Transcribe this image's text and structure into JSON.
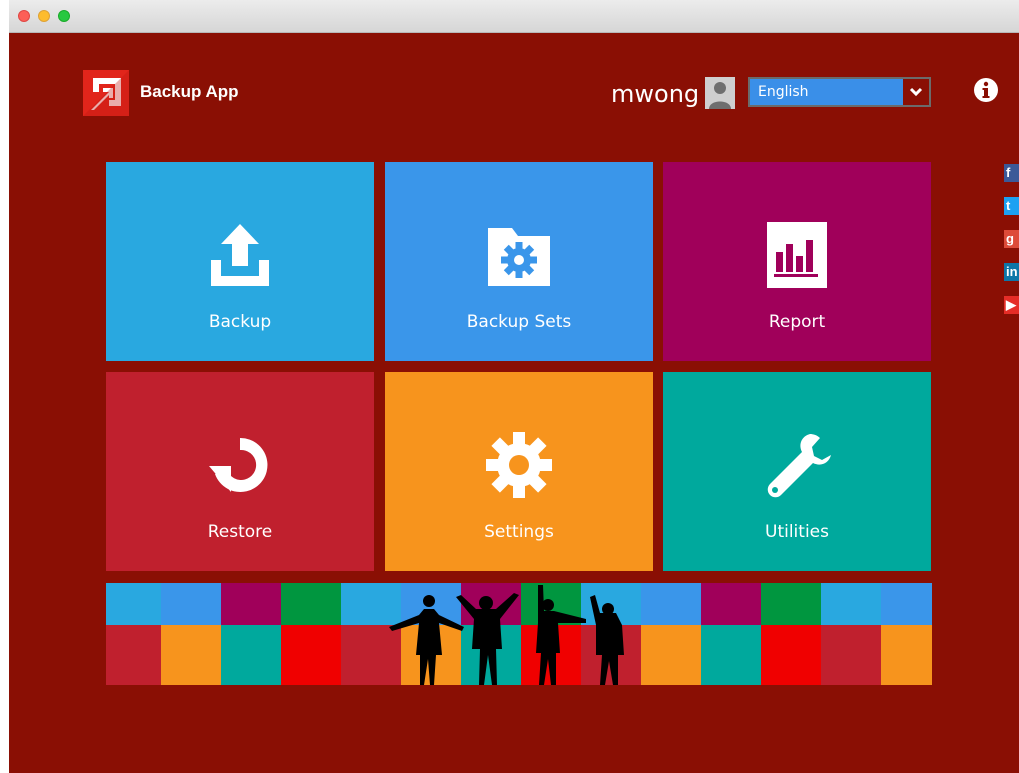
{
  "app": {
    "name": "Backup App"
  },
  "header": {
    "username": "mwong",
    "language": {
      "selected": "English"
    }
  },
  "tiles": [
    {
      "label": "Backup",
      "icon": "upload-icon",
      "color": "#29a8e0"
    },
    {
      "label": "Backup Sets",
      "icon": "folder-gear-icon",
      "color": "#3a96ea"
    },
    {
      "label": "Report",
      "icon": "report-chart-icon",
      "color": "#a0005a"
    },
    {
      "label": "Restore",
      "icon": "restore-icon",
      "color": "#c0202e"
    },
    {
      "label": "Settings",
      "icon": "gear-icon",
      "color": "#f7941d"
    },
    {
      "label": "Utilities",
      "icon": "wrench-icon",
      "color": "#00a99d"
    }
  ],
  "social": [
    {
      "name": "facebook-icon",
      "glyph": "f",
      "color": "#3b5998"
    },
    {
      "name": "twitter-icon",
      "glyph": "t",
      "color": "#1da1f2"
    },
    {
      "name": "googleplus-icon",
      "glyph": "g",
      "color": "#dd4b39"
    },
    {
      "name": "linkedin-icon",
      "glyph": "in",
      "color": "#0e76a8"
    },
    {
      "name": "youtube-icon",
      "glyph": "▶",
      "color": "#e52d27"
    }
  ],
  "colors": {
    "background": "#8a0f04",
    "accent": "#e1251b"
  }
}
